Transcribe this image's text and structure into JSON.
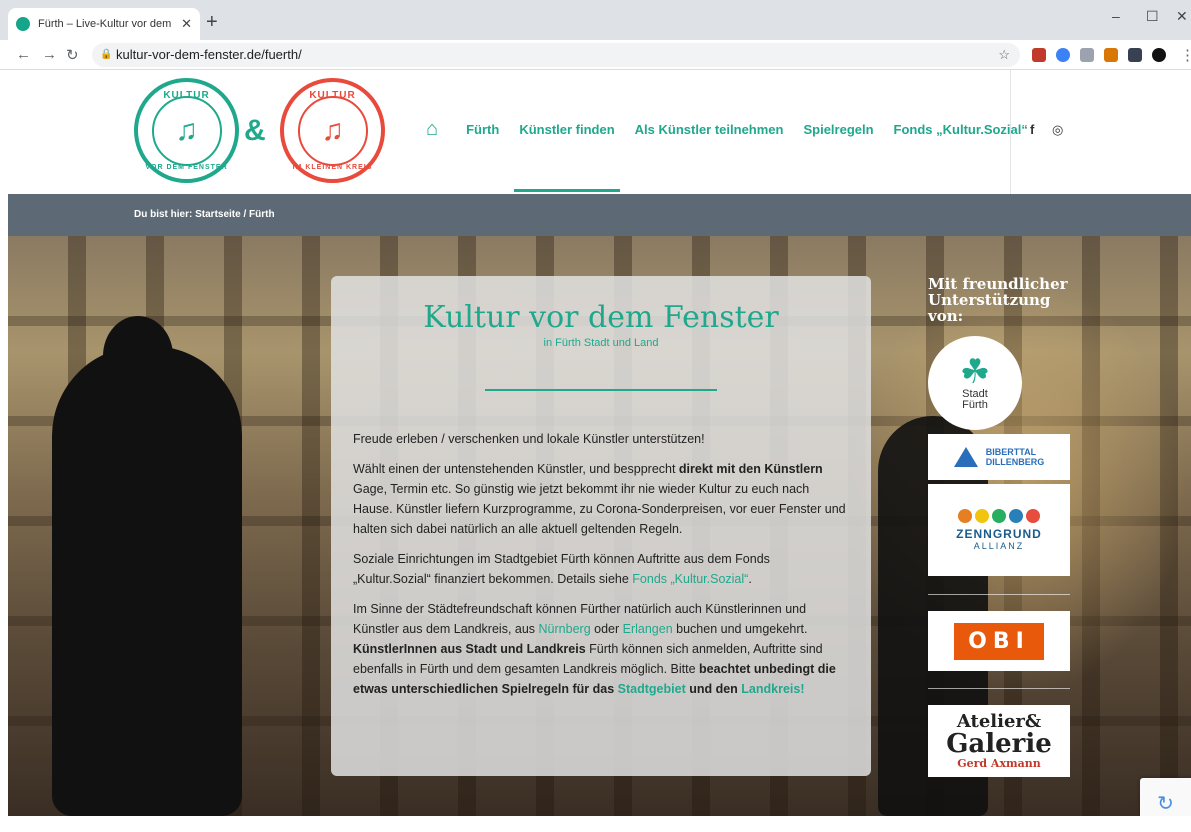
{
  "browser": {
    "tab_title": "Fürth – Live-Kultur vor dem Fenst",
    "tab_close": "✕",
    "new_tab": "+",
    "url": "kultur-vor-dem-fenster.de/fuerth/",
    "win_min": "–",
    "win_max": "☐",
    "win_close": "✕"
  },
  "logos": {
    "badge1_top": "KULTUR",
    "badge1_bottom": "VOR DEM FENSTER",
    "badge2_top": "KULTUR",
    "badge2_bottom": "IM KLEINEN KREIS",
    "amp": "&"
  },
  "menu": {
    "items": [
      "Fürth",
      "Künstler finden",
      "Als Künstler teilnehmen",
      "Spielregeln",
      "Fonds „Kultur.Sozial“"
    ]
  },
  "social": {
    "facebook": "f",
    "instagram": "◎"
  },
  "breadcrumb": "Du bist hier:  Startseite  / Fürth",
  "content": {
    "title": "Kultur vor dem Fenster",
    "subtitle": "in Fürth Stadt und Land",
    "p1": "Freude erleben / verschenken und lokale Künstler unterstützen!",
    "p2a": "Wählt einen der untenstehenden Künstler, und bespprecht ",
    "p2b": "direkt mit den Künstlern",
    "p2c": " Gage, Termin etc. So günstig wie jetzt bekommt ihr nie wieder Kultur zu euch nach Hause. Künstler liefern Kurzprogramme, zu Corona-Sonderpreisen, vor euer Fenster und halten sich dabei natürlich an alle aktuell geltenden Regeln.",
    "p3a": "Soziale Einrichtungen im Stadtgebiet Fürth können Auftritte aus dem Fonds „Kultur.Sozial“ finanziert bekommen. Details siehe ",
    "p3link": "Fonds „Kultur.Sozial“",
    "p3b": ".",
    "p4a": "Im Sinne der Städtefreundschaft können Fürther natürlich auch Künstlerinnen und Künstler aus dem Landkreis, aus ",
    "p4link1": "Nürnberg",
    "p4b": " oder ",
    "p4link2": "Erlangen",
    "p4c": " buchen und umgekehrt. ",
    "p4bold1": "KünstlerInnen aus Stadt und Landkreis",
    "p4d": " Fürth können sich anmelden, Auftritte sind ebenfalls in Fürth und dem gesamten Landkreis möglich. Bitte ",
    "p4bold2": "beachtet unbedingt die etwas unterschiedlichen Spielregeln für das ",
    "p4link3": "Stadtgebiet",
    "p4bold3": " und den ",
    "p4link4": "Landkreis!"
  },
  "sponsors": {
    "heading": "Mit freundlicher Unterstützung von:",
    "stadt": "Stadt\nFürth",
    "stadt_1": "Stadt",
    "stadt_2": "Fürth",
    "bibert_1": "BIBERTTAL",
    "bibert_2": "DILLENBERG",
    "zenn_1": "ZENNGRUND",
    "zenn_2": "ALLIANZ",
    "obi": "OBI",
    "atelier_1": "Atelier&",
    "atelier_2": "Galerie",
    "atelier_3": "Gerd Axmann"
  },
  "colors": {
    "accent": "#1fa88c",
    "red_badge": "#e84a3c",
    "breadcrumb_bg": "#5d6a75"
  }
}
